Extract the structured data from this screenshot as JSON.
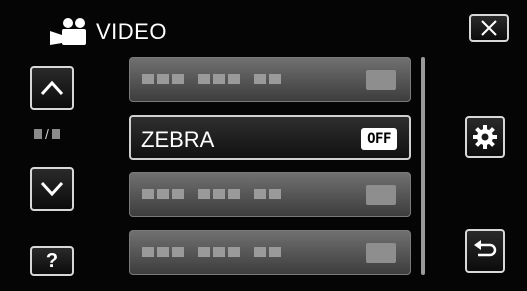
{
  "header": {
    "title": "VIDEO",
    "icon": "video-camera-icon"
  },
  "navigation": {
    "close_icon": "close-icon",
    "up_icon": "chevron-up-icon",
    "down_icon": "chevron-down-icon",
    "help_label": "?",
    "settings_icon": "gear-icon",
    "back_icon": "return-icon",
    "page_indicator_separator": "/"
  },
  "menu": {
    "items": [
      {
        "label": "",
        "value": "",
        "placeholder": true
      },
      {
        "label": "ZEBRA",
        "value": "OFF",
        "placeholder": false,
        "selected": true
      },
      {
        "label": "",
        "value": "",
        "placeholder": true
      },
      {
        "label": "",
        "value": "",
        "placeholder": true
      }
    ]
  },
  "colors": {
    "background": "#050505",
    "button_border": "#d8d8d8",
    "row_gray": "#5a5a5a",
    "badge_bg": "#ffffff"
  }
}
